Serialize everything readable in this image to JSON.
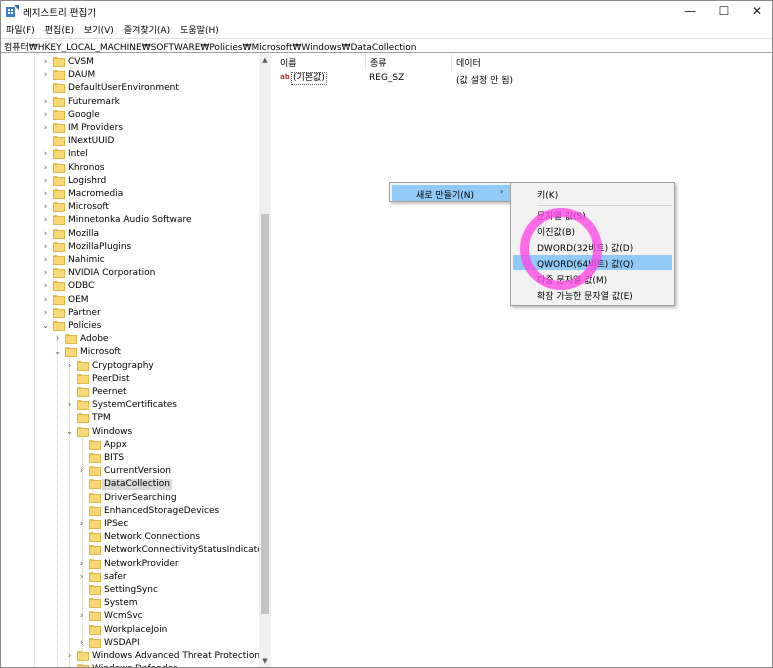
{
  "window": {
    "title": "레지스트리 편집기",
    "controls": {
      "minimize": "—",
      "maximize": "☐",
      "close": "✕"
    }
  },
  "menubar": [
    "파일(F)",
    "편집(E)",
    "보기(V)",
    "즐겨찾기(A)",
    "도움말(H)"
  ],
  "address": "컴퓨터₩HKEY_LOCAL_MACHINE₩SOFTWARE₩Policies₩Microsoft₩Windows₩DataCollection",
  "tree": [
    {
      "label": "CVSM",
      "level": 0,
      "expander": "›"
    },
    {
      "label": "DAUM",
      "level": 0,
      "expander": "›"
    },
    {
      "label": "DefaultUserEnvironment",
      "level": 0,
      "expander": ""
    },
    {
      "label": "Futuremark",
      "level": 0,
      "expander": "›"
    },
    {
      "label": "Google",
      "level": 0,
      "expander": "›"
    },
    {
      "label": "IM Providers",
      "level": 0,
      "expander": "›"
    },
    {
      "label": "INextUUID",
      "level": 0,
      "expander": ""
    },
    {
      "label": "Intel",
      "level": 0,
      "expander": "›"
    },
    {
      "label": "Khronos",
      "level": 0,
      "expander": "›"
    },
    {
      "label": "Logishrd",
      "level": 0,
      "expander": "›"
    },
    {
      "label": "Macromedia",
      "level": 0,
      "expander": "›"
    },
    {
      "label": "Microsoft",
      "level": 0,
      "expander": "›"
    },
    {
      "label": "Minnetonka Audio Software",
      "level": 0,
      "expander": "›"
    },
    {
      "label": "Mozilla",
      "level": 0,
      "expander": "›"
    },
    {
      "label": "MozillaPlugins",
      "level": 0,
      "expander": "›"
    },
    {
      "label": "Nahimic",
      "level": 0,
      "expander": "›"
    },
    {
      "label": "NVIDIA Corporation",
      "level": 0,
      "expander": "›"
    },
    {
      "label": "ODBC",
      "level": 0,
      "expander": "›"
    },
    {
      "label": "OEM",
      "level": 0,
      "expander": "›"
    },
    {
      "label": "Partner",
      "level": 0,
      "expander": "›"
    },
    {
      "label": "Policies",
      "level": 0,
      "expander": "⌄"
    },
    {
      "label": "Adobe",
      "level": 1,
      "expander": "›"
    },
    {
      "label": "Microsoft",
      "level": 1,
      "expander": "⌄"
    },
    {
      "label": "Cryptography",
      "level": 2,
      "expander": "›"
    },
    {
      "label": "PeerDist",
      "level": 2,
      "expander": ""
    },
    {
      "label": "Peernet",
      "level": 2,
      "expander": ""
    },
    {
      "label": "SystemCertificates",
      "level": 2,
      "expander": "›"
    },
    {
      "label": "TPM",
      "level": 2,
      "expander": ""
    },
    {
      "label": "Windows",
      "level": 2,
      "expander": "⌄"
    },
    {
      "label": "Appx",
      "level": 3,
      "expander": ""
    },
    {
      "label": "BITS",
      "level": 3,
      "expander": ""
    },
    {
      "label": "CurrentVersion",
      "level": 3,
      "expander": "›"
    },
    {
      "label": "DataCollection",
      "level": 3,
      "expander": "",
      "selected": true
    },
    {
      "label": "DriverSearching",
      "level": 3,
      "expander": ""
    },
    {
      "label": "EnhancedStorageDevices",
      "level": 3,
      "expander": ""
    },
    {
      "label": "IPSec",
      "level": 3,
      "expander": "›"
    },
    {
      "label": "Network Connections",
      "level": 3,
      "expander": ""
    },
    {
      "label": "NetworkConnectivityStatusIndicator",
      "level": 3,
      "expander": ""
    },
    {
      "label": "NetworkProvider",
      "level": 3,
      "expander": "›"
    },
    {
      "label": "safer",
      "level": 3,
      "expander": "›"
    },
    {
      "label": "SettingSync",
      "level": 3,
      "expander": ""
    },
    {
      "label": "System",
      "level": 3,
      "expander": ""
    },
    {
      "label": "WcmSvc",
      "level": 3,
      "expander": "›"
    },
    {
      "label": "WorkplaceJoin",
      "level": 3,
      "expander": ""
    },
    {
      "label": "WSDAPI",
      "level": 3,
      "expander": "›"
    },
    {
      "label": "Windows Advanced Threat Protection",
      "level": 2,
      "expander": "›"
    },
    {
      "label": "Windows Defender",
      "level": 2,
      "expander": "›"
    }
  ],
  "values_pane": {
    "columns": {
      "name": "이름",
      "type": "종류",
      "data": "데이터"
    },
    "rows": [
      {
        "icon": "ab",
        "name": "(기본값)",
        "type": "REG_SZ",
        "data": "(값 설정 안 됨)"
      }
    ]
  },
  "context_menu": {
    "new_label": "새로 만들기(N)",
    "arrow": "›",
    "submenu": [
      "키(K)",
      "문자열 값(S)",
      "이진값(B)",
      "DWORD(32비트) 값(D)",
      "QWORD(64비트) 값(Q)",
      "다중 문자열 값(M)",
      "확장 가능한 문자열 값(E)"
    ],
    "hovered_index": 4
  },
  "colors": {
    "menu_hover": "#91c9f7",
    "highlight_circle": "#ff46e6",
    "folder": "#f8d775"
  }
}
